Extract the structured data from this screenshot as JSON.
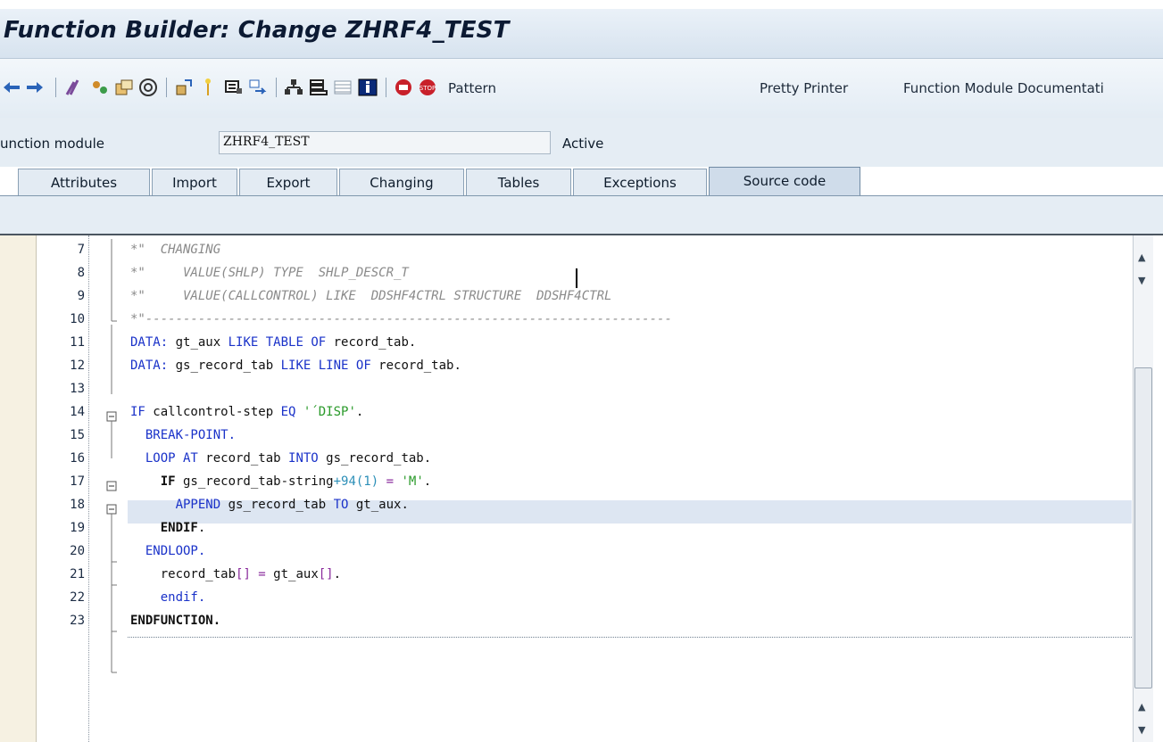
{
  "window": {
    "title": "Function Builder: Change ZHRF4_TEST"
  },
  "toolbar": {
    "icons": [
      "back-arrow-icon",
      "forward-arrow-icon",
      "check-syntax-icon",
      "display-change-icon",
      "activate-icon",
      "test-icon",
      "where-used-icon",
      "insert-icon",
      "display-object-list-icon",
      "navigation-icon",
      "hierarchy-icon",
      "object-list-icon",
      "frames-icon",
      "info-icon",
      "breakpoint-icon",
      "stop-icon"
    ],
    "pattern_label": "Pattern",
    "pretty_printer_label": "Pretty Printer",
    "fm_doc_label": "Function Module Documentati"
  },
  "fm": {
    "label": "unction module",
    "value": "ZHRF4_TEST",
    "status": "Active"
  },
  "tabs": [
    "Attributes",
    "Import",
    "Export",
    "Changing",
    "Tables",
    "Exceptions",
    "Source code"
  ],
  "active_tab": "Source code",
  "code": {
    "line_numbers": [
      "7",
      "8",
      "9",
      "10",
      "11",
      "12",
      "13",
      "14",
      "15",
      "16",
      "17",
      "18",
      "19",
      "20",
      "21",
      "22",
      "23"
    ],
    "l7": "*\"  CHANGING",
    "l8": "*\"     VALUE(SHLP) TYPE  SHLP_DESCR_T",
    "l9": "*\"     VALUE(CALLCONTROL) LIKE  DDSHF4CTRL STRUCTURE  DDSHF4CTRL",
    "l10": "*\"----------------------------------------------------------------------",
    "data": "DATA:",
    "l11_a": " gt_aux ",
    "like": "LIKE",
    "table_of": " TABLE OF ",
    "l11_b": "record_tab.",
    "l12_a": " gs_record_tab ",
    "line_of": " LINE OF ",
    "l12_b": "record_tab.",
    "if": "IF",
    "l14_a": " callcontrol-step ",
    "eq": "EQ",
    "l14_str": "'´DISP'",
    "dot": ".",
    "breakpoint": "  BREAK-POINT.",
    "loop_at": "  LOOP AT",
    "l16_a": " record_tab ",
    "into": "INTO",
    "l16_b": " gs_record_tab.",
    "l17_indent": "    ",
    "l17_a": " gs_record_tab-string",
    "plus94": "+94(1)",
    "eqsign": " = ",
    "l17_str": "'M'",
    "append": "      APPEND",
    "l18_a": " gs_record_tab ",
    "to": "TO",
    "l18_b": " gt_aux.",
    "endif_indent": "    ",
    "endif": "ENDIF",
    "endloop": "  ENDLOOP.",
    "l21_a": "    record_tab",
    "brackets": "[]",
    "eqsign2": " = ",
    "l21_b": "gt_aux",
    "brackets2": "[]",
    "l21_c": ".",
    "l22": "    endif.",
    "endfunction": "ENDFUNCTION."
  }
}
